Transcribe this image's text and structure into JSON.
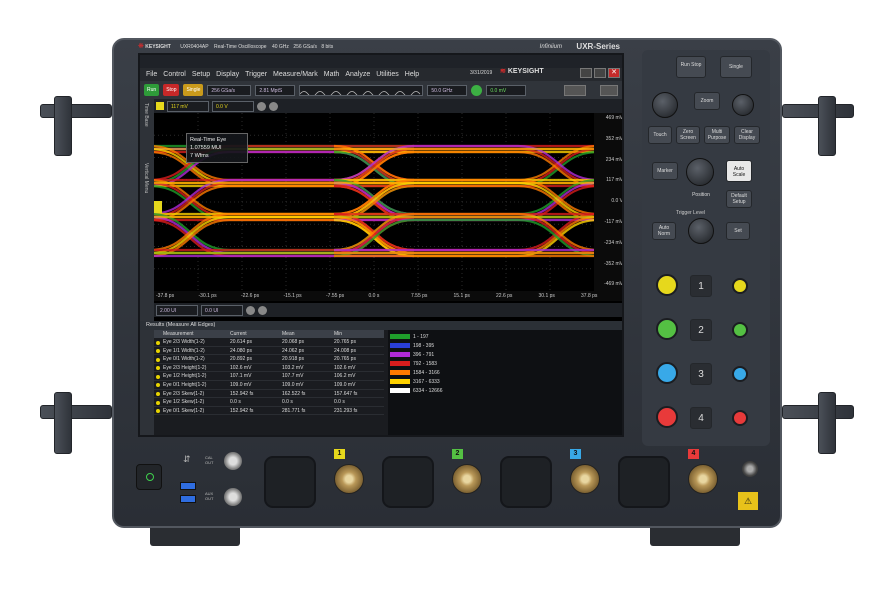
{
  "brand": "KEYSIGHT",
  "model": "UXR0404AP",
  "subtitle": "Real-Time Oscilloscope",
  "spec1": "40 GHz",
  "spec2": "256 GSa/s",
  "spec3": "8 bits",
  "series_brand": "Infiniium",
  "series": "UXR-Series",
  "menu": [
    "File",
    "Control",
    "Setup",
    "Display",
    "Trigger",
    "Measure/Mark",
    "Math",
    "Analyze",
    "Utilities",
    "Help"
  ],
  "date": "3/31/2019",
  "toolbar": {
    "run": "Run",
    "stop": "Stop",
    "single": "Single",
    "sample_rate": "256 GSa/s",
    "mem_depth": "2.81 MptS",
    "bandwidth": "50.0 GHz",
    "trig_level": "0.0 mV"
  },
  "trigger_row": {
    "level": "117 mV",
    "offset": "0.0 V"
  },
  "sidebar": [
    "Time Base",
    "Vertical Menu"
  ],
  "tooltip": {
    "title": "Real-Time Eye",
    "freq": "1.07559 MUI",
    "wfms": "7 Wfms"
  },
  "y_labels": [
    "469 mV",
    "352 mV",
    "234 mV",
    "117 mV",
    "0.0 V",
    "-117 mV",
    "-234 mV",
    "-352 mV",
    "-469 mV"
  ],
  "x_labels": [
    "-37.8 ps",
    "-30.1 ps",
    "-22.6 ps",
    "-15.1 ps",
    "-7.55 ps",
    "0.0 s",
    "7.55 ps",
    "15.1 ps",
    "22.6 ps",
    "30.1 ps",
    "37.8 ps"
  ],
  "horiz_row": {
    "scale": "2.00 UI",
    "position": "0.0 UI"
  },
  "results": {
    "title": "Results (Measure All Edges)",
    "columns": [
      "Measurement",
      "Current",
      "Mean",
      "Min"
    ],
    "rows": [
      [
        "Eye 2/3 Width(1-2)",
        "20.614 ps",
        "20.068 ps",
        "20.765 ps"
      ],
      [
        "Eye 1/1 Width(1-2)",
        "24.080 ps",
        "24.062 ps",
        "24.008 ps"
      ],
      [
        "Eye 0/1 Width(1-2)",
        "20.892 ps",
        "20.918 ps",
        "20.765 ps"
      ],
      [
        "Eye 2/3 Height(1-2)",
        "102.6 mV",
        "103.2 mV",
        "102.6 mV"
      ],
      [
        "Eye 1/2 Height(1-2)",
        "107.1 mV",
        "107.7 mV",
        "106.2 mV"
      ],
      [
        "Eye 0/1 Height(1-2)",
        "109.0 mV",
        "109.0 mV",
        "109.0 mV"
      ],
      [
        "Eye 2/3 Skew(1-2)",
        "152.942 fs",
        "162.522 fs",
        "157.647 fs"
      ],
      [
        "Eye 1/2 Skew(1-2)",
        "0.0 s",
        "0.0 s",
        "0.0 s"
      ],
      [
        "Eye 0/1 Skew(1-2)",
        "152.942 fs",
        "281.771 fs",
        "231.293 fs"
      ]
    ]
  },
  "legend": [
    "1 - 197",
    "198 - 395",
    "396 - 791",
    "792 - 1583",
    "1584 - 3166",
    "3167 - 6333",
    "6334 - 12666"
  ],
  "legend_colors": [
    "#1f9d2b",
    "#2a3fd8",
    "#b02ad8",
    "#d81d1d",
    "#ff7a00",
    "#ffd200",
    "#ffffff"
  ],
  "panel": {
    "run_stop": "Run Stop",
    "single": "Single",
    "zoom": "Zoom",
    "touch": "Touch",
    "zero_screen": "Zero Screen",
    "multi_purpose": "Multi Purpose",
    "clear_display": "Clear Display",
    "marker": "Marker",
    "auto_scale": "Auto Scale",
    "position": "Position",
    "default_setup": "Default Setup",
    "trigger_level": "Trigger Level",
    "auto_norm": "Auto Norm",
    "set": "Set"
  },
  "channel_colors": [
    "#e6d81c",
    "#54c043",
    "#38a9e8",
    "#e83a3a"
  ],
  "channels": [
    "1",
    "2",
    "3",
    "4"
  ],
  "aux_labels": [
    "CAL OUT",
    "AUX OUT"
  ]
}
